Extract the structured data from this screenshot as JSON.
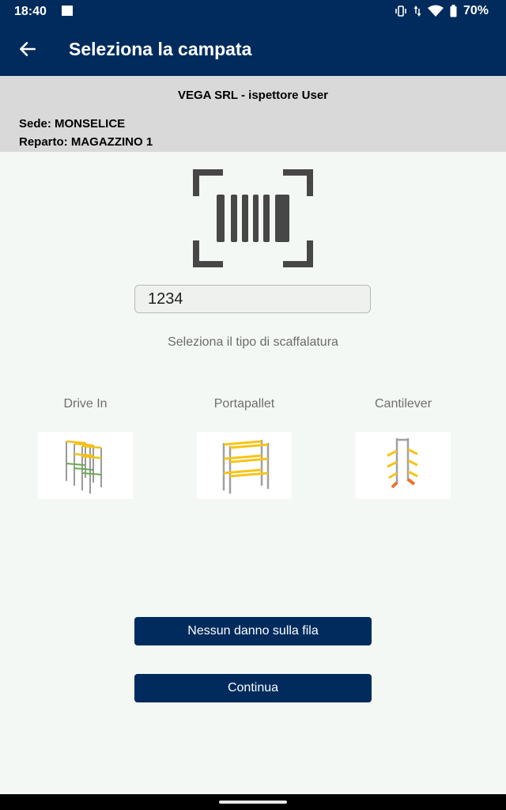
{
  "status": {
    "time": "18:40",
    "battery": "70%"
  },
  "appbar": {
    "title": "Seleziona la campata"
  },
  "info": {
    "company": "VEGA SRL - ispettore User",
    "sede": "Sede: MONSELICE",
    "reparto": "Reparto: MAGAZZINO 1"
  },
  "scan": {
    "code_value": "1234"
  },
  "instruction": "Seleziona il tipo di scaffalatura",
  "rack_types": [
    {
      "label": "Drive In"
    },
    {
      "label": "Portapallet"
    },
    {
      "label": "Cantilever"
    }
  ],
  "buttons": {
    "no_damage": "Nessun danno sulla fila",
    "continue": "Continua"
  },
  "colors": {
    "primary": "#002b5c",
    "accent_yellow": "#f5c518",
    "accent_orange": "#e8742a"
  }
}
